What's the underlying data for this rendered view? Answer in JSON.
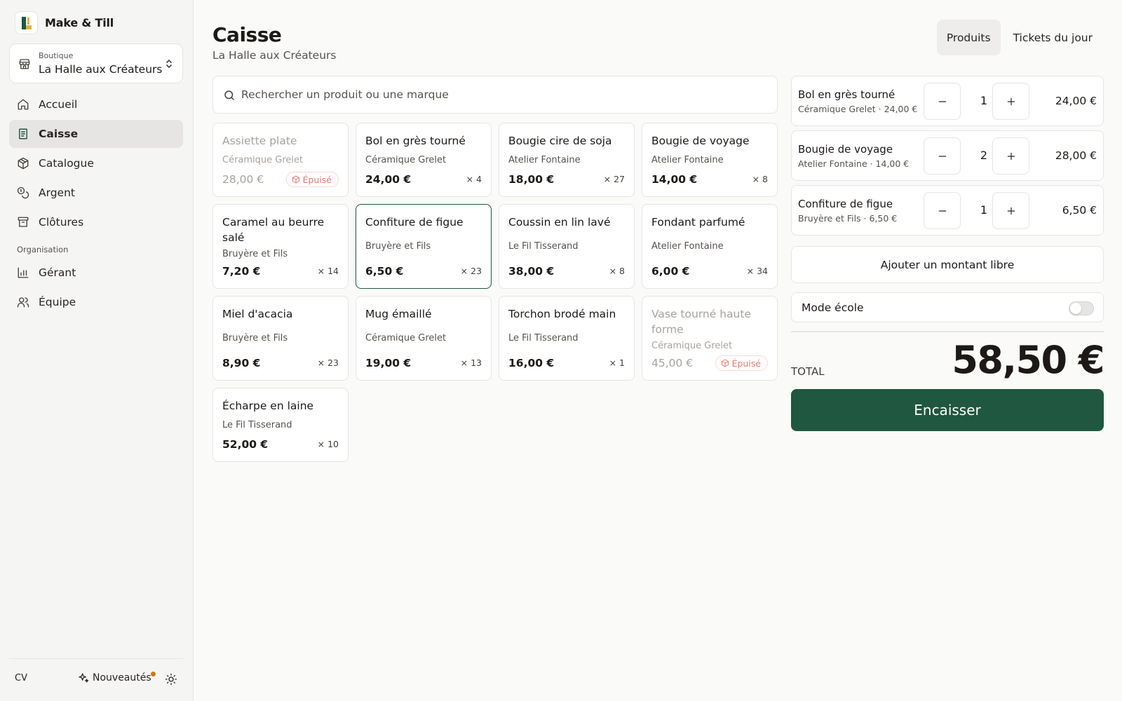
{
  "app": {
    "name": "Make & Till"
  },
  "store": {
    "label": "Boutique",
    "value": "La Halle aux Créateurs"
  },
  "nav": {
    "items": [
      {
        "label": "Accueil",
        "icon": "home-icon"
      },
      {
        "label": "Caisse",
        "icon": "receipt-icon",
        "active": true
      },
      {
        "label": "Catalogue",
        "icon": "package-icon"
      },
      {
        "label": "Argent",
        "icon": "coins-icon"
      },
      {
        "label": "Clôtures",
        "icon": "archive-icon"
      }
    ],
    "section_label": "Organisation",
    "org_items": [
      {
        "label": "Gérant",
        "icon": "chart-icon"
      },
      {
        "label": "Équipe",
        "icon": "users-icon"
      }
    ]
  },
  "footer": {
    "avatar": "CV",
    "news_label": "Nouveautés"
  },
  "header": {
    "title": "Caisse",
    "subtitle": "La Halle aux Créateurs"
  },
  "tabs": [
    {
      "label": "Produits",
      "active": true
    },
    {
      "label": "Tickets du jour",
      "active": false
    }
  ],
  "search": {
    "placeholder": "Rechercher un produit ou une marque",
    "value": ""
  },
  "products": [
    {
      "name": "Assiette plate",
      "brand": "Céramique Grelet",
      "price": "28,00 €",
      "stock": "",
      "soldout": true,
      "badge": "Épuisé"
    },
    {
      "name": "Bol en grès tourné",
      "brand": "Céramique Grelet",
      "price": "24,00 €",
      "stock": "× 4"
    },
    {
      "name": "Bougie cire de soja",
      "brand": "Atelier Fontaine",
      "price": "18,00 €",
      "stock": "× 27"
    },
    {
      "name": "Bougie de voyage",
      "brand": "Atelier Fontaine",
      "price": "14,00 €",
      "stock": "× 8"
    },
    {
      "name": "Caramel au beurre salé",
      "brand": "Bruyère et Fils",
      "price": "7,20 €",
      "stock": "× 14"
    },
    {
      "name": "Confiture de figue",
      "brand": "Bruyère et Fils",
      "price": "6,50 €",
      "stock": "× 23",
      "selected": true
    },
    {
      "name": "Coussin en lin lavé",
      "brand": "Le Fil Tisserand",
      "price": "38,00 €",
      "stock": "× 8"
    },
    {
      "name": "Fondant parfumé",
      "brand": "Atelier Fontaine",
      "price": "6,00 €",
      "stock": "× 34"
    },
    {
      "name": "Miel d'acacia",
      "brand": "Bruyère et Fils",
      "price": "8,90 €",
      "stock": "× 23"
    },
    {
      "name": "Mug émaillé",
      "brand": "Céramique Grelet",
      "price": "19,00 €",
      "stock": "× 13"
    },
    {
      "name": "Torchon brodé main",
      "brand": "Le Fil Tisserand",
      "price": "16,00 €",
      "stock": "× 1"
    },
    {
      "name": "Vase tourné haute forme",
      "brand": "Céramique Grelet",
      "price": "45,00 €",
      "stock": "",
      "soldout": true,
      "badge": "Épuisé"
    },
    {
      "name": "Écharpe en laine",
      "brand": "Le Fil Tisserand",
      "price": "52,00 €",
      "stock": "× 10"
    }
  ],
  "cart": {
    "lines": [
      {
        "name": "Bol en grès tourné",
        "meta": "Céramique Grelet · 24,00 €",
        "qty": "1",
        "total": "24,00 €"
      },
      {
        "name": "Bougie de voyage",
        "meta": "Atelier Fontaine · 14,00 €",
        "qty": "2",
        "total": "28,00 €"
      },
      {
        "name": "Confiture de figue",
        "meta": "Bruyère et Fils · 6,50 €",
        "qty": "1",
        "total": "6,50 €"
      }
    ],
    "free_amount_label": "Ajouter un montant libre",
    "school_mode_label": "Mode école",
    "school_mode_on": false,
    "total_label": "TOTAL",
    "total_value": "58,50 €",
    "checkout_label": "Encaisser"
  },
  "colors": {
    "accent": "#1f5740",
    "soldout_badge": "#e07a6e",
    "news_dot": "#d97706"
  }
}
